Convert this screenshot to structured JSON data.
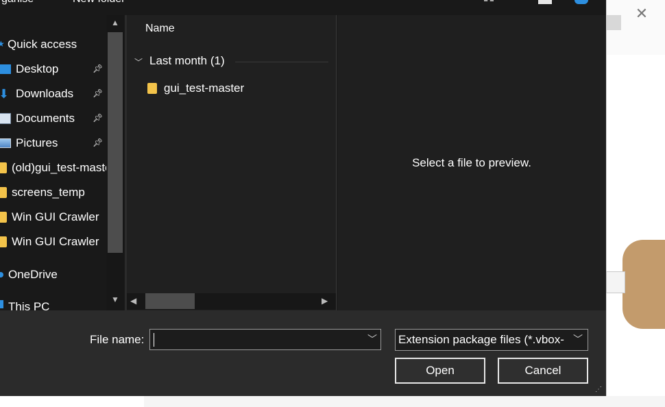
{
  "window": {
    "top_bar": {
      "partial_left": "ganise",
      "partial_new_folder": "New folder"
    }
  },
  "nav": {
    "items": [
      {
        "label": "Quick access",
        "icon": "star-icon",
        "pinned": false
      },
      {
        "label": "Desktop",
        "icon": "desktop-icon",
        "pinned": true
      },
      {
        "label": "Downloads",
        "icon": "download-arrow-icon",
        "pinned": true
      },
      {
        "label": "Documents",
        "icon": "documents-icon",
        "pinned": true
      },
      {
        "label": "Pictures",
        "icon": "pictures-icon",
        "pinned": true
      },
      {
        "label": "(old)gui_test-master",
        "icon": "folder-icon",
        "pinned": false
      },
      {
        "label": "screens_temp",
        "icon": "folder-icon",
        "pinned": false
      },
      {
        "label": "Win GUI Crawler",
        "icon": "folder-icon",
        "pinned": false
      },
      {
        "label": "Win GUI Crawler",
        "icon": "folder-icon",
        "pinned": false
      },
      {
        "label": "OneDrive",
        "icon": "cloud-icon",
        "pinned": false
      },
      {
        "label": "This PC",
        "icon": "computer-icon",
        "pinned": false
      }
    ]
  },
  "files": {
    "column_name": "Name",
    "group_label": "Last month (1)",
    "items": [
      {
        "name": "gui_test-master",
        "icon": "folder-icon"
      }
    ]
  },
  "preview": {
    "message": "Select a file to preview."
  },
  "bottom": {
    "file_name_label": "File name:",
    "file_name_value": "",
    "filter_value": "Extension package files (*.vbox-",
    "open_label": "Open",
    "cancel_label": "Cancel"
  },
  "colors": {
    "dialog_bg": "#191919",
    "pane_bg": "#202020",
    "bottom_bg": "#2b2b2b",
    "folder": "#f3c34a",
    "accent_blue": "#2d8fe0"
  }
}
